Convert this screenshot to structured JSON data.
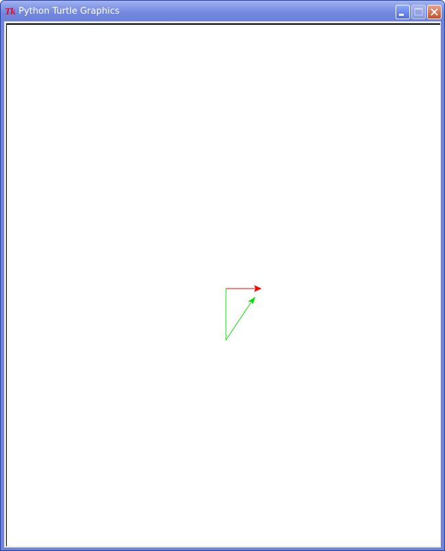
{
  "window": {
    "title": "Python Turtle Graphics",
    "app_icon_text": "Tk"
  },
  "titlebar_buttons": {
    "minimize": "minimize",
    "maximize": "maximize",
    "close": "close"
  },
  "colors": {
    "titlebar": "#6b80da",
    "red_arrow": "#ff0000",
    "green_arrow": "#00e000",
    "canvas_bg": "#ffffff",
    "frame": "#ece9d8"
  },
  "turtles": [
    {
      "name": "red-turtle",
      "color": "red"
    },
    {
      "name": "green-turtle",
      "color": "green"
    }
  ]
}
